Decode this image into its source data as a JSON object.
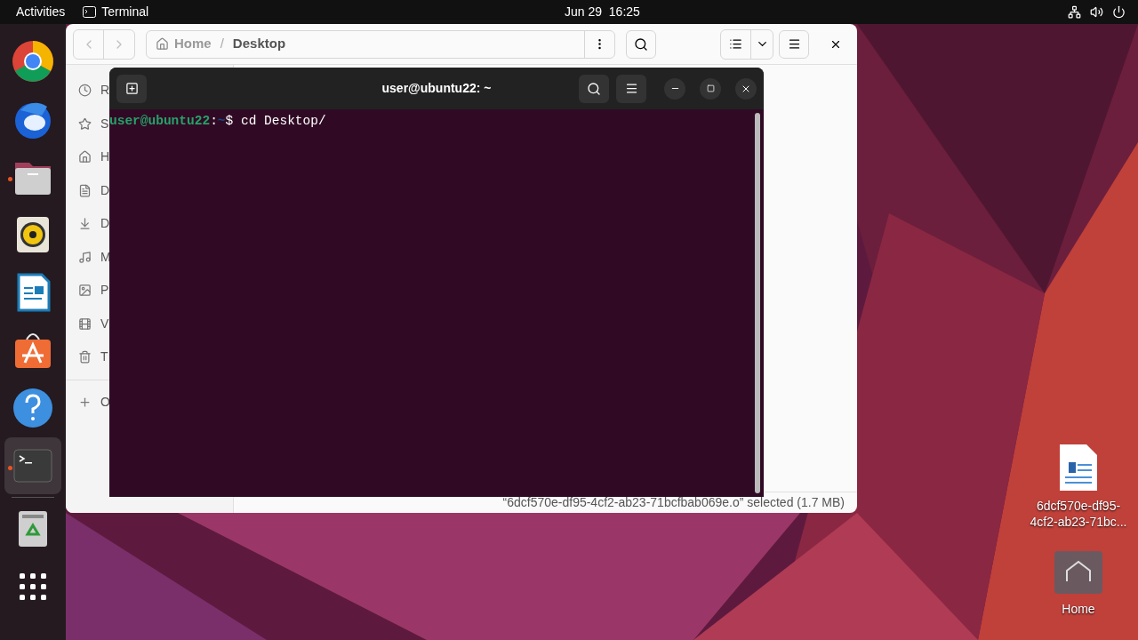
{
  "top_bar": {
    "activities": "Activities",
    "app": "Terminal",
    "clock": "Jun 29  16:25"
  },
  "dock": [
    {
      "kind": "chrome",
      "running": false,
      "selected": false
    },
    {
      "kind": "mail",
      "running": false,
      "selected": false
    },
    {
      "kind": "files",
      "running": true,
      "selected": false
    },
    {
      "kind": "music",
      "running": false,
      "selected": false
    },
    {
      "kind": "writer",
      "running": false,
      "selected": false
    },
    {
      "kind": "store",
      "running": false,
      "selected": false
    },
    {
      "kind": "help",
      "running": false,
      "selected": false
    },
    {
      "kind": "terminal",
      "running": true,
      "selected": true
    },
    {
      "kind": "trash",
      "running": false,
      "selected": false
    },
    {
      "kind": "apps",
      "running": false,
      "selected": false
    }
  ],
  "files_window": {
    "path": [
      "Home",
      "Desktop"
    ],
    "path_separator": "/",
    "sidebar": [
      {
        "kind": "recent",
        "label": "R"
      },
      {
        "kind": "starred",
        "label": "S"
      },
      {
        "kind": "home",
        "label": "H"
      },
      {
        "kind": "documents",
        "label": "D"
      },
      {
        "kind": "downloads",
        "label": "D"
      },
      {
        "kind": "music",
        "label": "M"
      },
      {
        "kind": "pictures",
        "label": "P"
      },
      {
        "kind": "videos",
        "label": "V"
      },
      {
        "kind": "trash",
        "label": "T"
      },
      {
        "kind": "other",
        "label": "O"
      }
    ],
    "status": "“6dcf570e-df95-4cf2-ab23-71bcfbab069e.o” selected (1.7 MB)"
  },
  "terminal": {
    "title": "user@ubuntu22: ~",
    "lines": [
      {
        "user": "user@ubuntu22",
        "sep": ":",
        "dir": "~",
        "prompt": "$",
        "command": "cd Desktop/"
      }
    ]
  },
  "desktop_icons": [
    {
      "kind": "document",
      "label": "6dcf570e-df95-\n4cf2-ab23-71bc..."
    },
    {
      "kind": "home",
      "label": "Home"
    }
  ]
}
